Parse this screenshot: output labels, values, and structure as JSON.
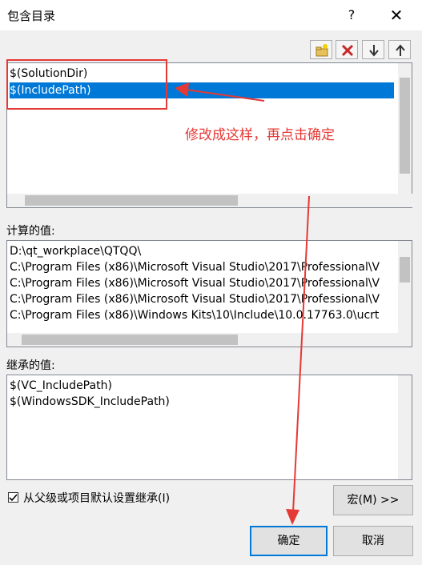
{
  "window": {
    "title": "包含目录",
    "help_label": "?",
    "close_label": "✕"
  },
  "toolbar": {
    "new_line": "new-folder-icon",
    "delete": "delete-icon",
    "move_down": "arrow-down-icon",
    "move_up": "arrow-up-icon"
  },
  "entries": [
    "$(SolutionDir)",
    "$(IncludePath)"
  ],
  "selected_entry": "$(IncludePath)",
  "computed": {
    "label": "计算的值:",
    "lines": [
      "D:\\qt_workplace\\QTQQ\\",
      "C:\\Program Files (x86)\\Microsoft Visual Studio\\2017\\Professional\\V",
      "C:\\Program Files (x86)\\Microsoft Visual Studio\\2017\\Professional\\V",
      "C:\\Program Files (x86)\\Microsoft Visual Studio\\2017\\Professional\\V",
      "C:\\Program Files (x86)\\Windows Kits\\10\\Include\\10.0.17763.0\\ucrt"
    ]
  },
  "inherited": {
    "label": "继承的值:",
    "lines": [
      "$(VC_IncludePath)",
      "$(WindowsSDK_IncludePath)"
    ]
  },
  "inherit_checkbox": {
    "label": "从父级或项目默认设置继承(I)",
    "checked": true
  },
  "buttons": {
    "macros": "宏(M) >>",
    "ok": "确定",
    "cancel": "取消"
  },
  "annotation": {
    "text": "修改成这样，再点击确定",
    "color": "#e53935"
  },
  "colors": {
    "selection": "#0078d7",
    "accent": "#0078d7"
  }
}
